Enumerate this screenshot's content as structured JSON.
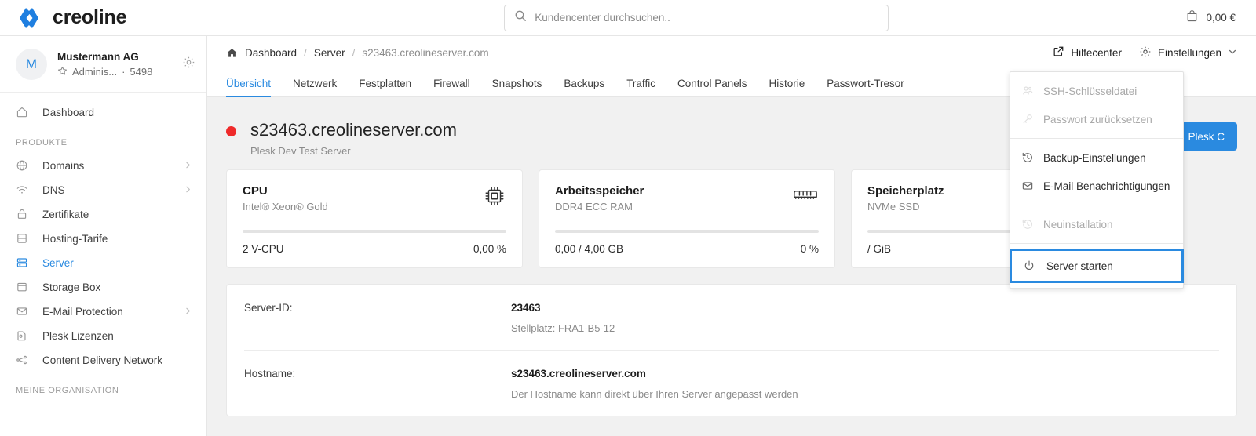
{
  "topbar": {
    "brand_name": "creoline",
    "logo_icon": "creoline-logo",
    "search": {
      "placeholder": "Kundencenter durchsuchen..",
      "value": "",
      "icon": "search-icon"
    },
    "cart": {
      "icon": "shopping-bag-icon",
      "amount": "0,00 €"
    }
  },
  "sidebar": {
    "org": {
      "avatar_initial": "M",
      "name": "Mustermann AG",
      "star_icon": "star-icon",
      "role": "Adminis...",
      "separator": "·",
      "customer_number": "5498",
      "gear_icon": "gear-icon"
    },
    "top_items": [
      {
        "label": "Dashboard",
        "icon": "home-icon",
        "active": false,
        "chevron": false
      }
    ],
    "sections": [
      {
        "title": "PRODUKTE",
        "items": [
          {
            "label": "Domains",
            "icon": "globe-icon",
            "active": false,
            "chevron": true
          },
          {
            "label": "DNS",
            "icon": "wifi-icon",
            "active": false,
            "chevron": true
          },
          {
            "label": "Zertifikate",
            "icon": "lock-icon",
            "active": false,
            "chevron": false
          },
          {
            "label": "Hosting-Tarife",
            "icon": "database-icon",
            "active": false,
            "chevron": false
          },
          {
            "label": "Server",
            "icon": "server-icon",
            "active": true,
            "chevron": false
          },
          {
            "label": "Storage Box",
            "icon": "box-icon",
            "active": false,
            "chevron": false
          },
          {
            "label": "E-Mail Protection",
            "icon": "mail-icon",
            "active": false,
            "chevron": true
          },
          {
            "label": "Plesk Lizenzen",
            "icon": "license-icon",
            "active": false,
            "chevron": false
          },
          {
            "label": "Content Delivery Network",
            "icon": "network-icon",
            "active": false,
            "chevron": false
          }
        ]
      },
      {
        "title": "MEINE ORGANISATION",
        "items": []
      }
    ]
  },
  "breadcrumb": {
    "home_icon": "home-icon",
    "items": [
      "Dashboard",
      "Server"
    ],
    "separator": "/",
    "current": "s23463.creolineserver.com"
  },
  "header_actions": {
    "help_icon": "external-link-icon",
    "help_label": "Hilfecenter",
    "settings_icon": "gear-icon",
    "settings_label": "Einstellungen",
    "settings_chevron": "chevron-down-icon"
  },
  "tabs": [
    {
      "label": "Übersicht",
      "active": true
    },
    {
      "label": "Netzwerk",
      "active": false
    },
    {
      "label": "Festplatten",
      "active": false
    },
    {
      "label": "Firewall",
      "active": false
    },
    {
      "label": "Snapshots",
      "active": false
    },
    {
      "label": "Backups",
      "active": false
    },
    {
      "label": "Traffic",
      "active": false
    },
    {
      "label": "Control Panels",
      "active": false
    },
    {
      "label": "Historie",
      "active": false
    },
    {
      "label": "Passwort-Tresor",
      "active": false
    }
  ],
  "page": {
    "status_color": "#ef2a2a",
    "title": "s23463.creolineserver.com",
    "subtitle": "Plesk Dev Test Server",
    "primary_button": {
      "label": "Plesk C",
      "icon": "external-link-icon",
      "color": "#2a8ae0"
    }
  },
  "cards": [
    {
      "title": "CPU",
      "subtitle": "Intel® Xeon® Gold",
      "icon": "cpu-chip-icon",
      "meter_percent": 0,
      "left_value": "2 V-CPU",
      "right_value": "0,00 %"
    },
    {
      "title": "Arbeitsspeicher",
      "subtitle": "DDR4 ECC RAM",
      "icon": "memory-ram-icon",
      "meter_percent": 0,
      "left_value": "0,00 / 4,00 GB",
      "right_value": "0 %"
    },
    {
      "title": "Speicherplatz",
      "subtitle": "NVMe SSD",
      "icon": "disk-icon",
      "meter_percent": 0,
      "left_value": "/ GiB",
      "right_value": ""
    }
  ],
  "details": [
    {
      "label": "Server-ID:",
      "value": "23463",
      "note": "Stellplatz: FRA1-B5-12"
    },
    {
      "label": "Hostname:",
      "value": "s23463.creolineserver.com",
      "note": "Der Hostname kann direkt über Ihren Server angepasst werden"
    }
  ],
  "dropdown": {
    "groups": [
      [
        {
          "label": "SSH-Schlüsseldatei",
          "icon": "users-key-icon",
          "disabled": true,
          "highlighted": false
        },
        {
          "label": "Passwort zurücksetzen",
          "icon": "key-icon",
          "disabled": true,
          "highlighted": false
        }
      ],
      [
        {
          "label": "Backup-Einstellungen",
          "icon": "history-icon",
          "disabled": false,
          "highlighted": false
        },
        {
          "label": "E-Mail Benachrichtigungen",
          "icon": "mail-icon",
          "disabled": false,
          "highlighted": false
        }
      ],
      [
        {
          "label": "Neuinstallation",
          "icon": "history-icon",
          "disabled": true,
          "highlighted": false
        }
      ],
      [
        {
          "label": "Server starten",
          "icon": "power-icon",
          "disabled": false,
          "highlighted": true
        }
      ]
    ]
  }
}
